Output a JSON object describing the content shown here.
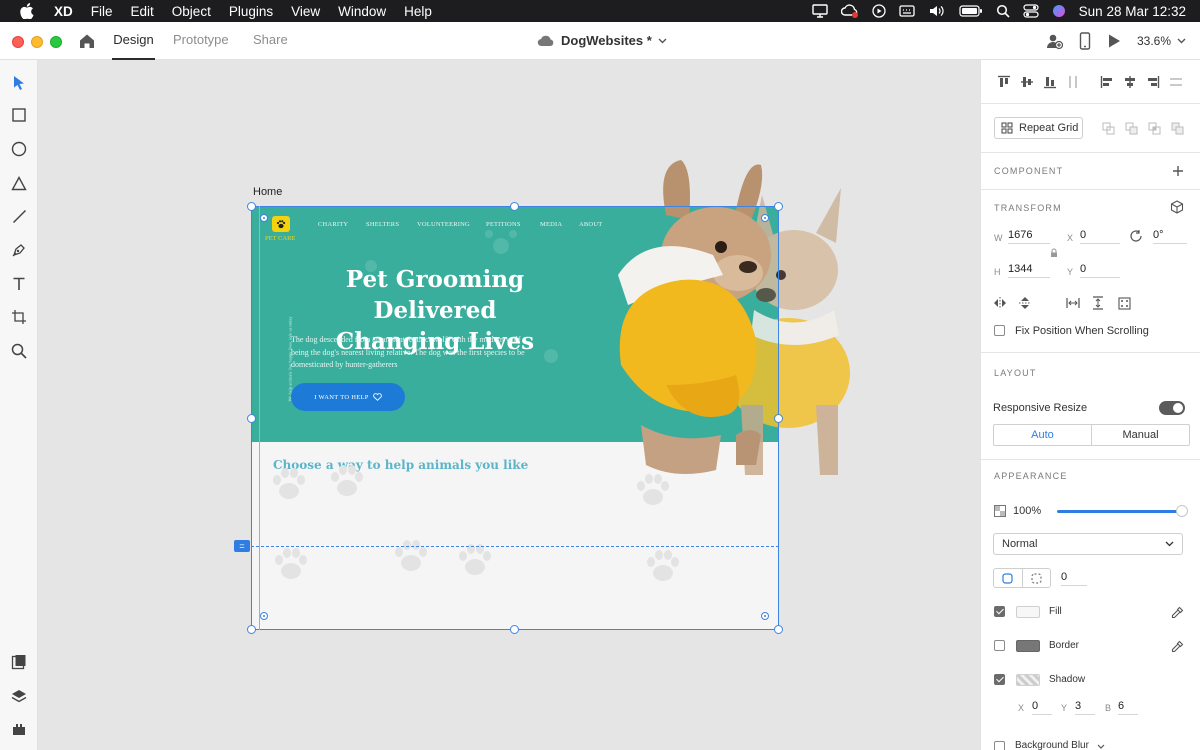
{
  "menubar": {
    "app": "XD",
    "items": [
      "File",
      "Edit",
      "Object",
      "Plugins",
      "View",
      "Window",
      "Help"
    ],
    "clock": "Sun 28 Mar  12:32"
  },
  "titlebar": {
    "tabs": [
      "Design",
      "Prototype",
      "Share"
    ],
    "active_tab": "Design",
    "doc_title": "DogWebsites *",
    "zoom": "33.6%"
  },
  "canvas": {
    "artboard_label": "Home",
    "site": {
      "logo_text": "PET CARE",
      "nav": [
        "CHARITY",
        "SHELTERS",
        "VOLUNTEERING",
        "PETITIONS",
        "MEDIA",
        "ABOUT"
      ],
      "side_text": "We help animals live happy lives, join us today",
      "hero_title_line1": "Pet Grooming Delivered",
      "hero_title_line2": "Changing Lives",
      "hero_sub": "The dog descended from an ancient, extinct wolf, with the modern wolf being the dog's nearest living relative. The dog was the first species to be domesticated by hunter-gatherers",
      "cta": "I WANT TO HELP",
      "section_heading": "Choose a way to help animals you like",
      "hero_color": "#3aae9c",
      "cta_color": "#1d7bd7",
      "heading_color": "#5bb4c9"
    }
  },
  "panel": {
    "repeat_grid": "Repeat Grid",
    "component_head": "COMPONENT",
    "transform_head": "TRANSFORM",
    "w_label": "W",
    "w_value": "1676",
    "h_label": "H",
    "h_value": "1344",
    "x_label": "X",
    "x_value": "0",
    "y_label": "Y",
    "y_value": "0",
    "rotation": "0°",
    "fix_position": "Fix Position When Scrolling",
    "layout_head": "LAYOUT",
    "responsive_resize": "Responsive Resize",
    "responsive_modes": [
      "Auto",
      "Manual"
    ],
    "appearance_head": "APPEARANCE",
    "opacity": "100%",
    "blend_mode": "Normal",
    "corner_radius": "0",
    "fill_label": "Fill",
    "border_label": "Border",
    "shadow_label": "Shadow",
    "shadow_x_label": "X",
    "shadow_x": "0",
    "shadow_y_label": "Y",
    "shadow_y": "3",
    "shadow_b_label": "B",
    "shadow_b": "6",
    "background_blur": "Background Blur",
    "accent_color": "#2f7de1"
  }
}
